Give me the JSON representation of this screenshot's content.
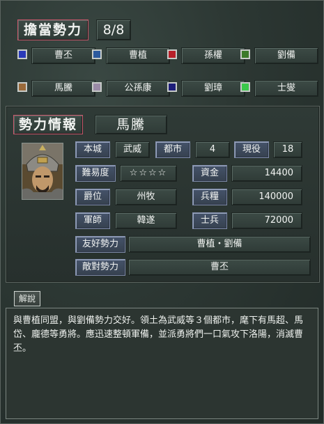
{
  "header": {
    "title": "擔當勢力",
    "count": "8/8"
  },
  "factions": [
    {
      "name": "曹丕",
      "color": "#2a3ab8"
    },
    {
      "name": "曹植",
      "color": "#2d5a9e"
    },
    {
      "name": "孫權",
      "color": "#b8202a"
    },
    {
      "name": "劉備",
      "color": "#3c7a2a"
    },
    {
      "name": "馬騰",
      "color": "#9a6a3a"
    },
    {
      "name": "公孫康",
      "color": "#9a8aa6"
    },
    {
      "name": "劉璋",
      "color": "#1e1e7a"
    },
    {
      "name": "士燮",
      "color": "#3ac84a"
    }
  ],
  "info": {
    "title": "勢力情報",
    "ruler": "馬騰",
    "labels": {
      "castle": "本城",
      "cities": "都市",
      "status": "現役",
      "difficulty": "難易度",
      "funds": "資金",
      "rank": "爵位",
      "food": "兵糧",
      "advisor": "軍師",
      "troops": "士兵",
      "friendly": "友好勢力",
      "hostile": "敵對勢力"
    },
    "values": {
      "castle": "武威",
      "cities": "4",
      "status": "18",
      "difficulty": "☆☆☆☆",
      "funds": "14400",
      "rank": "州牧",
      "food": "140000",
      "advisor": "韓遂",
      "troops": "72000",
      "friendly": "曹植・劉備",
      "hostile": "曹丕"
    }
  },
  "description": {
    "label": "解說",
    "text": "與曹植同盟，與劉備勢力交好。領土為武威等３個都市，麾下有馬超、馬岱、龐德等勇將。應迅速整頓軍備，並派勇將們一口氣攻下洛陽，消滅曹丕。"
  }
}
